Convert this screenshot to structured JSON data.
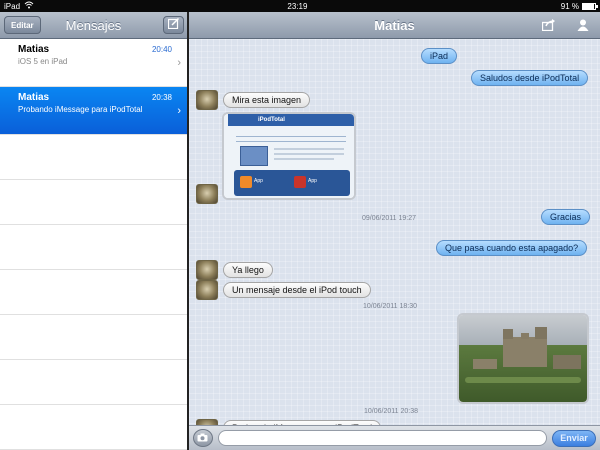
{
  "status_bar": {
    "device": "iPad",
    "time": "23:19",
    "battery": "91 %",
    "battery_fraction": 0.91
  },
  "sidebar": {
    "edit_label": "Editar",
    "title": "Mensajes",
    "conversations": [
      {
        "name": "Matias",
        "preview": "iOS 5 en iPad",
        "time": "20:40",
        "selected": false
      },
      {
        "name": "Matias",
        "preview": "Probando iMessage para iPodTotal",
        "time": "20:38",
        "selected": true
      }
    ]
  },
  "chat": {
    "title": "Matias",
    "messages": {
      "m1": "iPad",
      "m2": "Saludos desde iPodTotal",
      "m3": "Mira esta imagen",
      "m4": "Gracias",
      "m5": "Que pasa cuando esta apagado?",
      "m6": "Ya llego",
      "m7": "Un mensaje desde el iPod touch",
      "m8": "Probando iMessage para iPodTotal"
    },
    "timestamps": {
      "t1": "09/06/2011 19:27",
      "t2": "10/06/2011 18:30",
      "t3": "10/06/2011 20:38"
    },
    "screenshot_text": {
      "logo": "iPodTotal",
      "left_app": "App",
      "right_app": "App"
    }
  },
  "composer": {
    "placeholder": "",
    "send_label": "Enviar"
  },
  "colors": {
    "accent": "#0a6fe6",
    "out_bubble": "#8fc6f5",
    "in_bubble": "#f2f2f2"
  }
}
